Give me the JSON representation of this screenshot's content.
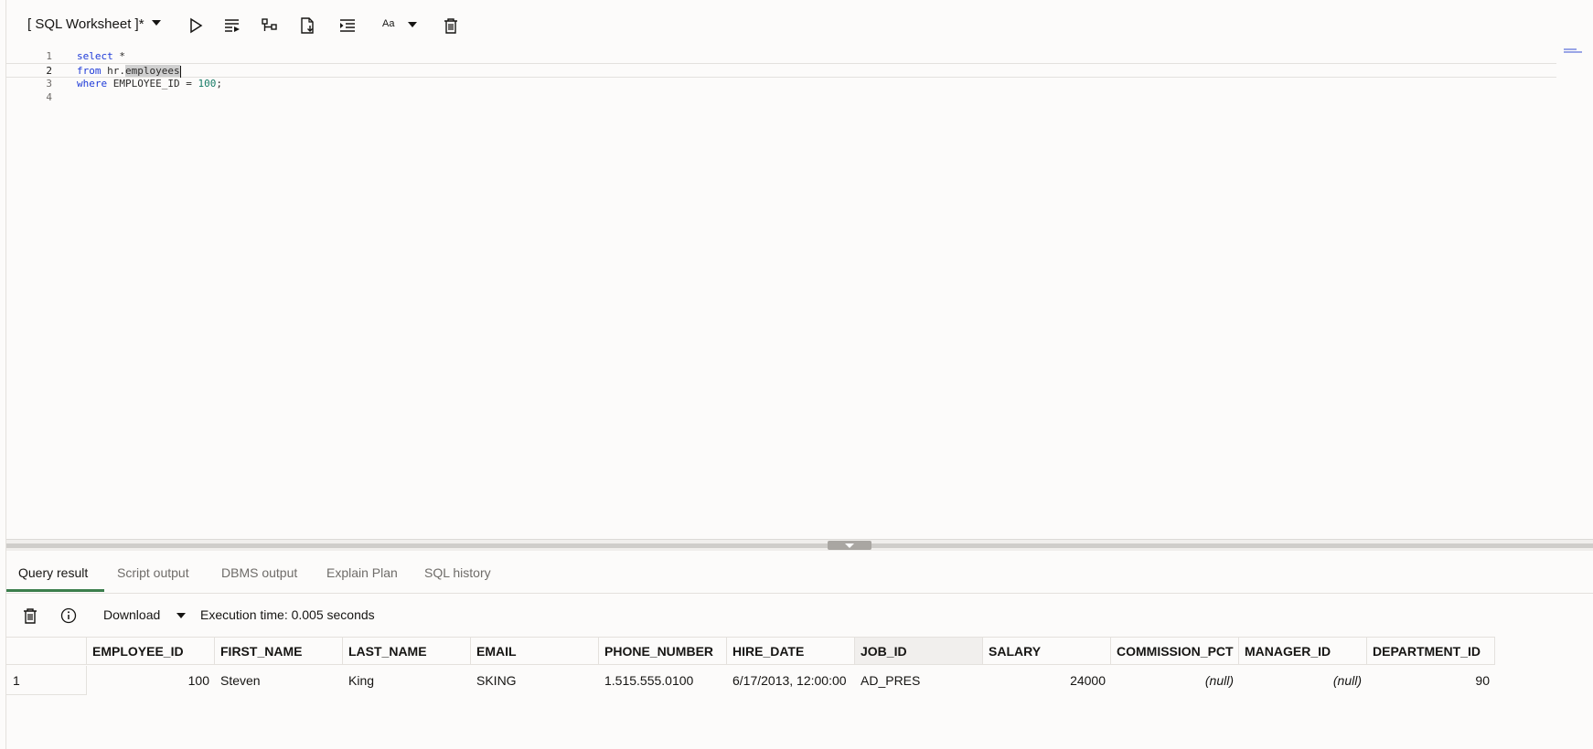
{
  "toolbar": {
    "worksheet_title": "[ SQL Worksheet ]*",
    "font_label": "Aa",
    "icons": [
      "run-statement-icon",
      "run-script-icon",
      "explain-plan-icon",
      "autotrace-icon",
      "format-icon",
      "font-size-icon",
      "clear-icon"
    ]
  },
  "editor": {
    "line_numbers": [
      "1",
      "2",
      "3",
      "4"
    ],
    "line1": {
      "kw": "select",
      "rest": " *"
    },
    "line2": {
      "kw": "from",
      "pre": " hr.",
      "selected": "employees"
    },
    "line3": {
      "kw": "where",
      "mid": " EMPLOYEE_ID = ",
      "num": "100",
      "end": ";"
    }
  },
  "tabs": [
    "Query result",
    "Script output",
    "DBMS output",
    "Explain Plan",
    "SQL history"
  ],
  "result_toolbar": {
    "download_label": "Download",
    "execution_time": "Execution time: 0.005 seconds"
  },
  "grid": {
    "columns": [
      "EMPLOYEE_ID",
      "FIRST_NAME",
      "LAST_NAME",
      "EMAIL",
      "PHONE_NUMBER",
      "HIRE_DATE",
      "JOB_ID",
      "SALARY",
      "COMMISSION_PCT",
      "MANAGER_ID",
      "DEPARTMENT_ID"
    ],
    "rows": [
      {
        "num": "1",
        "values": [
          "100",
          "Steven",
          "King",
          "SKING",
          "1.515.555.0100",
          "6/17/2013, 12:00:00",
          "AD_PRES",
          "24000",
          "(null)",
          "(null)",
          "90"
        ]
      }
    ]
  },
  "colors": {
    "accent_tab": "#3b7e4c",
    "keyword": "#1f3bd8",
    "number": "#167b66"
  }
}
